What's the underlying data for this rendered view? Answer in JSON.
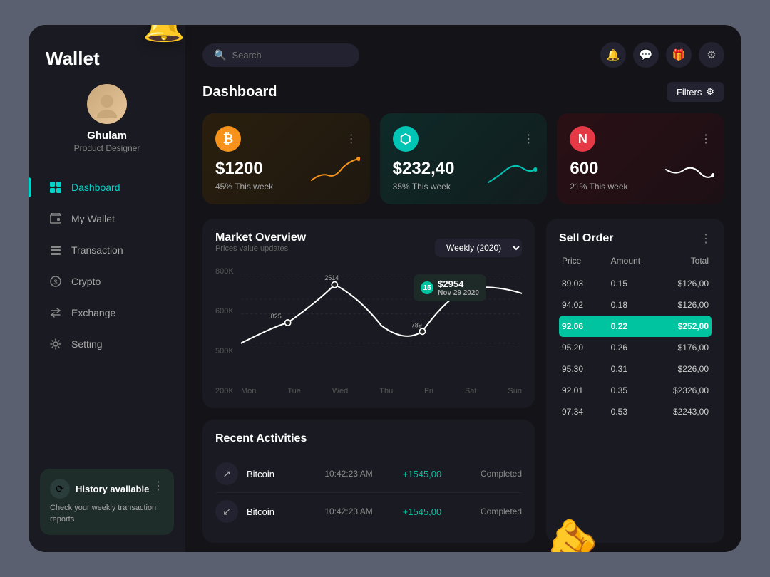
{
  "app": {
    "title": "Wallet",
    "brand": "Wallet"
  },
  "sidebar": {
    "profile": {
      "name": "Ghulam",
      "role": "Product Designer"
    },
    "nav": [
      {
        "id": "dashboard",
        "label": "Dashboard",
        "icon": "⊞",
        "active": true
      },
      {
        "id": "my-wallet",
        "label": "My Wallet",
        "icon": "◻",
        "active": false
      },
      {
        "id": "transaction",
        "label": "Transaction",
        "icon": "⊟",
        "active": false
      },
      {
        "id": "crypto",
        "label": "Crypto",
        "icon": "◎",
        "active": false
      },
      {
        "id": "exchange",
        "label": "Exchange",
        "icon": "↻",
        "active": false
      },
      {
        "id": "setting",
        "label": "Setting",
        "icon": "⚙",
        "active": false
      }
    ],
    "history": {
      "title": "History available",
      "description": "Check your weekly transaction reports"
    }
  },
  "topbar": {
    "search_placeholder": "Search",
    "actions": [
      "bell",
      "message",
      "gift",
      "settings"
    ]
  },
  "dashboard": {
    "title": "Dashboard",
    "filters_label": "Filters",
    "cards": [
      {
        "id": "btc",
        "symbol": "B",
        "value": "$1200",
        "change": "45%",
        "period": "This week",
        "color": "btc"
      },
      {
        "id": "eth",
        "symbol": "⬡",
        "value": "$232,40",
        "change": "35%",
        "period": "This week",
        "color": "eth"
      },
      {
        "id": "neo",
        "symbol": "N",
        "value": "600",
        "change": "21%",
        "period": "This week",
        "color": "neo"
      }
    ]
  },
  "market": {
    "title": "Market Overview",
    "subtitle": "Prices value updates",
    "period": "Weekly (2020)",
    "days": [
      "Mon",
      "Tue",
      "Wed",
      "Thu",
      "Fri",
      "Sat",
      "Sun"
    ],
    "y_labels": [
      "800K",
      "600K",
      "500K",
      "200K"
    ],
    "data_points": [
      "825",
      "2514",
      "",
      "789",
      "",
      "2954",
      ""
    ],
    "tooltip": {
      "badge": "15",
      "value": "$2954",
      "date": "Nov 29 2020"
    }
  },
  "recent_activities": {
    "title": "Recent Activities",
    "rows": [
      {
        "icon": "↗",
        "name": "Bitcoin",
        "time": "10:42:23 AM",
        "amount": "+1545,00",
        "status": "Completed"
      },
      {
        "icon": "↙",
        "name": "Bitcoin",
        "time": "10:42:23 AM",
        "amount": "+1545,00",
        "status": "Completed"
      }
    ]
  },
  "sell_order": {
    "title": "Sell Order",
    "headers": [
      "Price",
      "Amount",
      "Total"
    ],
    "rows": [
      {
        "price": "89.03",
        "amount": "0.15",
        "total": "$126,00",
        "highlight": false
      },
      {
        "price": "94.02",
        "amount": "0.18",
        "total": "$126,00",
        "highlight": false
      },
      {
        "price": "92.06",
        "amount": "0.22",
        "total": "$252,00",
        "highlight": true
      },
      {
        "price": "95.20",
        "amount": "0.26",
        "total": "$176,00",
        "highlight": false
      },
      {
        "price": "95.30",
        "amount": "0.31",
        "total": "$226,00",
        "highlight": false
      },
      {
        "price": "92.01",
        "amount": "0.35",
        "total": "$2326,00",
        "highlight": false
      },
      {
        "price": "97.34",
        "amount": "0.53",
        "total": "$2243,00",
        "highlight": false
      }
    ]
  }
}
